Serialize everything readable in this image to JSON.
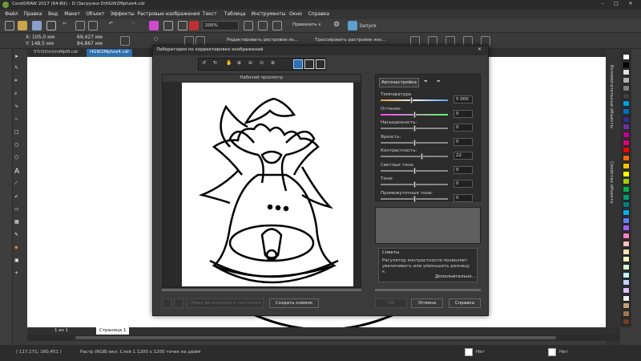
{
  "window": {
    "title": "CorelDRAW 2017 (64-Bit) - D:\\Загрузки D\\HGW2Mphze4.cdr"
  },
  "menu": [
    "Файл",
    "Правка",
    "Вид",
    "Макет",
    "Объект",
    "Эффекты",
    "Растровые изображения",
    "Текст",
    "Таблица",
    "Инструменты",
    "Окно",
    "Справка"
  ],
  "toolbar": {
    "zoom": "200%",
    "snap": "Привязать к",
    "launch": "Запуск"
  },
  "propbar": {
    "x": "X: 105,0 мм",
    "y": "Y: 148,5 мм",
    "w": "69,427 мм",
    "h": "84,867 мм",
    "edit_bitmap": "Редактировать растровое из...",
    "trace_bitmap": "Трассировать растровое изо..."
  },
  "doc_tabs": [
    "5YrQVmUmMpM.cdr",
    "HGW2Mphze4.cdr"
  ],
  "dialog": {
    "title": "Лаборатория по корректировке изображений",
    "preview_label": "Рабочий просмотр",
    "auto_button": "Автонастройка",
    "params": [
      {
        "label": "Температура",
        "value": "5 000",
        "pos": 0.45
      },
      {
        "label": "Оттенок:",
        "value": "0",
        "pos": 0.5
      },
      {
        "label": "Насыщенность:",
        "value": "0",
        "pos": 0.5
      },
      {
        "label": "Яркость:",
        "value": "0",
        "pos": 0.5
      },
      {
        "label": "Контрастность:",
        "value": "22",
        "pos": 0.61
      },
      {
        "label": "Светлые тона:",
        "value": "0",
        "pos": 0.5
      },
      {
        "label": "Тени:",
        "value": "0",
        "pos": 0.5
      },
      {
        "label": "Промежуточные тона:",
        "value": "0",
        "pos": 0.5
      }
    ],
    "tips_title": "Советы",
    "tips_text": "Регулятор контрастности позволяет увеличивать или уменьшать разницу к",
    "tips_more": "Дополнительно...",
    "reset_button": "Сброс до исходного состояния",
    "snapshot_button": "Создать снимок",
    "ok_button": "ОК",
    "cancel_button": "Отмена",
    "help_button": "Справка"
  },
  "right_tabs": [
    "Вспомогательные объекты",
    "Свойства объекта"
  ],
  "page": {
    "current": "1 из 1",
    "tab": "Страница 1"
  },
  "status": {
    "coords": "( 117,171; 160,451 )",
    "info": "Растр (RGB) вкл. Слой 1 1200 x 1200 точек на дюйм",
    "fill_none": "Нет",
    "outline_none": "Нет"
  },
  "palette": [
    "#ffffff",
    "#000000",
    "#e0e0e0",
    "#b0b0b0",
    "#808080",
    "#404040",
    "#00a0e0",
    "#0070c0",
    "#303090",
    "#7030a0",
    "#c00090",
    "#e0007a",
    "#ff0000",
    "#ff6600",
    "#ffc000",
    "#ffff00",
    "#a0d000",
    "#00b050",
    "#00a070",
    "#008080",
    "#00b0f0",
    "#6080ff",
    "#a060ff",
    "#ff80c0",
    "#ffc0c0",
    "#ffe0b0",
    "#ffffc0",
    "#d0ffd0",
    "#c0ffff",
    "#c0d0ff",
    "#e0c0ff",
    "#f0f0f0",
    "#c8a078",
    "#a07850",
    "#704020"
  ]
}
